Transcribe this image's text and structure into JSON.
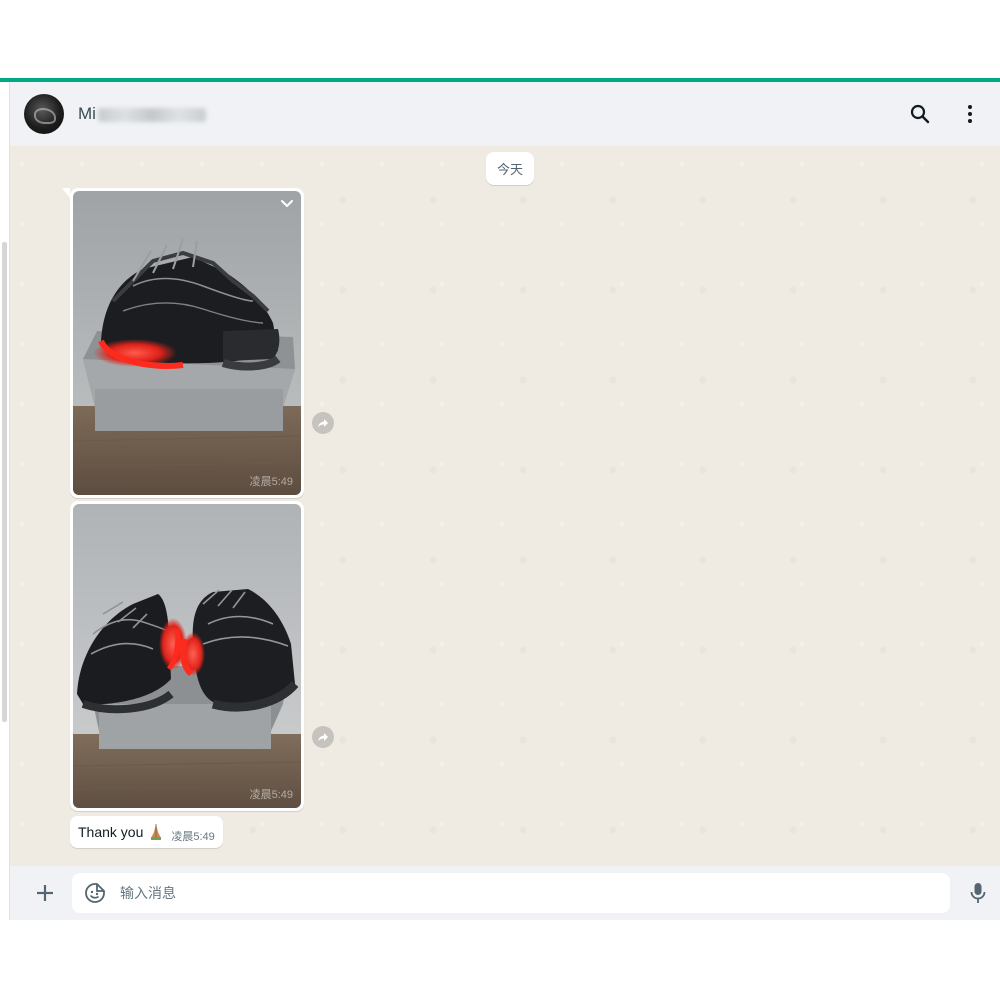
{
  "header": {
    "contact_name_visible": "Mi",
    "search_icon": "search-icon",
    "menu_icon": "kebab-menu-icon"
  },
  "chat": {
    "date_divider": "今天",
    "images": [
      {
        "description_icon": "photo",
        "time": "凌晨5:49"
      },
      {
        "description_icon": "photo",
        "time": "凌晨5:49"
      }
    ],
    "text_message": {
      "text": "Thank you",
      "emoji": "🙏",
      "time": "凌晨5:49"
    }
  },
  "footer": {
    "attach_icon": "plus-icon",
    "sticker_icon": "sticker-icon",
    "input_placeholder": "输入消息",
    "mic_icon": "microphone-icon"
  },
  "colors": {
    "accent": "#00a884",
    "chat_bg": "#efeae2",
    "header_bg": "#f0f2f5",
    "bubble_bg": "#ffffff"
  }
}
